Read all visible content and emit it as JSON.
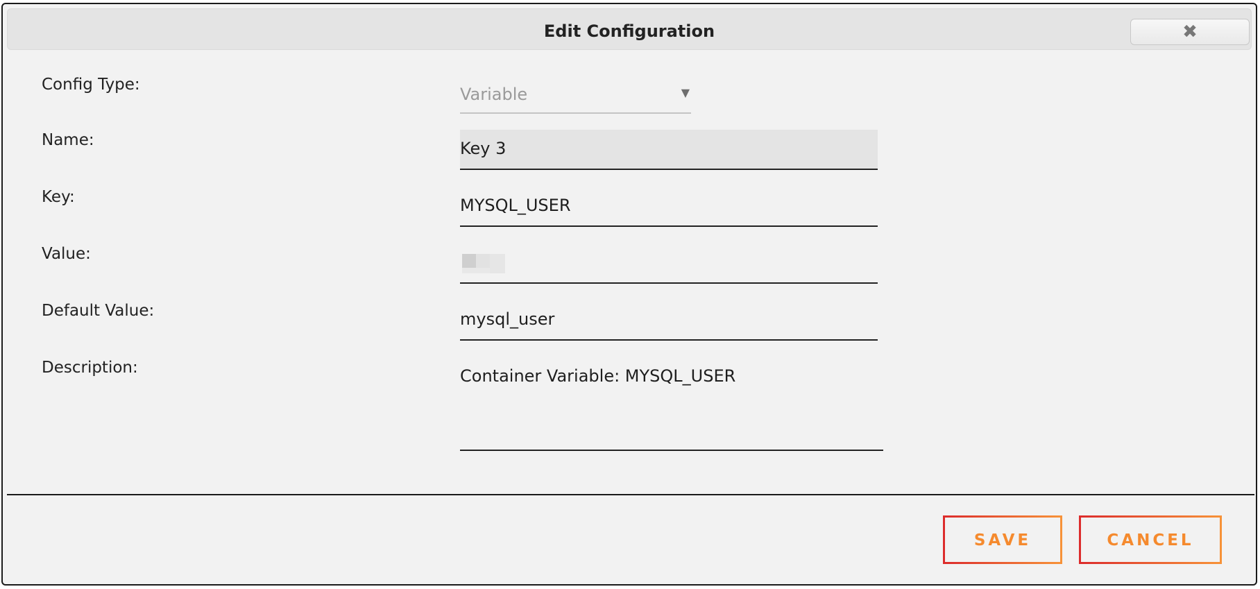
{
  "dialog": {
    "title": "Edit Configuration",
    "close_icon": "close-icon"
  },
  "form": {
    "config_type": {
      "label": "Config Type:",
      "value": "Variable",
      "icon": "chevron-down-icon"
    },
    "name": {
      "label": "Name:",
      "value": "Key 3"
    },
    "key": {
      "label": "Key:",
      "value": "MYSQL_USER"
    },
    "value": {
      "label": "Value:"
    },
    "default_value": {
      "label": "Default Value:",
      "value": "mysql_user"
    },
    "description": {
      "label": "Description:",
      "value": "Container Variable: MYSQL_USER"
    }
  },
  "footer": {
    "save_label": "SAVE",
    "cancel_label": "CANCEL"
  },
  "colors": {
    "accent_start": "#dc2c2c",
    "accent_end": "#f79238",
    "button_text": "#f58a2e"
  }
}
